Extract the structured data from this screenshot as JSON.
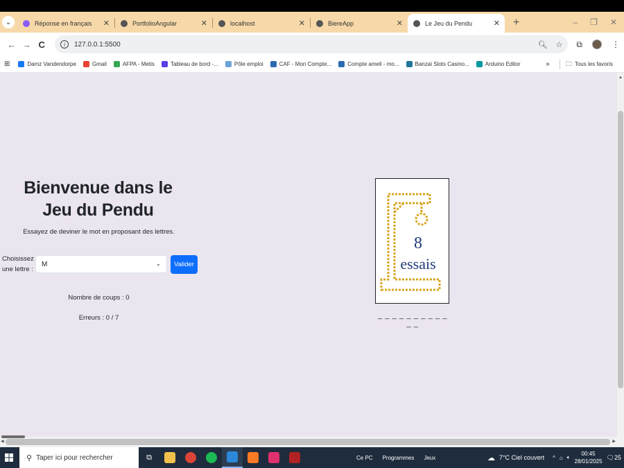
{
  "browser": {
    "tabs": [
      {
        "title": "Réponse en français",
        "color": "#8a5cf6",
        "active": false
      },
      {
        "title": "PortfolioAngular",
        "color": "#555555",
        "active": false
      },
      {
        "title": "localhost",
        "color": "#555555",
        "active": false
      },
      {
        "title": "BiereApp",
        "color": "#555555",
        "active": false
      },
      {
        "title": "Le Jeu du Pendu",
        "color": "#555555",
        "active": true
      }
    ],
    "url": "127.0.0.1:5500",
    "bookmarks": [
      {
        "label": "Damz Vandendorpe",
        "color": "#1877f2"
      },
      {
        "label": "Gmail",
        "color": "#ea4335"
      },
      {
        "label": "AFPA - Metis",
        "color": "#34a853"
      },
      {
        "label": "Tableau de bord -...",
        "color": "#5b3ce8"
      },
      {
        "label": "Pôle emploi",
        "color": "#6aa3d8"
      },
      {
        "label": "CAF - Mon Compte...",
        "color": "#2b6cb0"
      },
      {
        "label": "Compte ameli - mo...",
        "color": "#2b6cb0"
      },
      {
        "label": "Banzai Slots Casino...",
        "color": "#21759b"
      },
      {
        "label": "Arduino Editor",
        "color": "#00979d"
      }
    ],
    "all_bookmarks": "Tous les favoris",
    "more": "»"
  },
  "game": {
    "title": "Bienvenue dans le Jeu du Pendu",
    "subtitle": "Essayez de deviner le mot en proposant des lettres.",
    "select_label": "Choisissez une lettre :",
    "selected_letter": "M",
    "submit": "Valider",
    "moves": "Nombre de coups : 0",
    "errors": "Erreurs : 0 / 7",
    "tries_number": "8",
    "tries_word": "essais",
    "word_mask": "_ _ _ _ _ _ _ _ _ _ _ _",
    "accent": "#0d6efd"
  },
  "taskbar": {
    "search_placeholder": "Taper ici pour rechercher",
    "links": [
      "Ce PC",
      "Programmes",
      "Jeux"
    ],
    "weather": "7°C  Ciel couvert",
    "time": "00:45",
    "date": "28/01/2025",
    "notif_count": "25"
  }
}
